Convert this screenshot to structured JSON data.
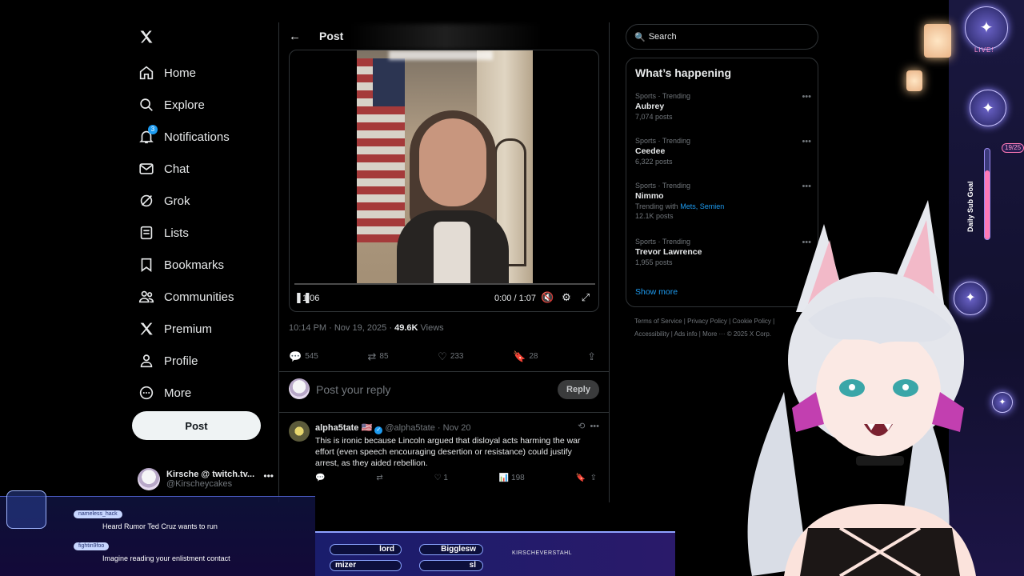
{
  "nav": {
    "items": [
      {
        "label": "Home",
        "icon": "home-icon"
      },
      {
        "label": "Explore",
        "icon": "search-icon"
      },
      {
        "label": "Notifications",
        "icon": "bell-icon",
        "badge": "3"
      },
      {
        "label": "Chat",
        "icon": "mail-icon"
      },
      {
        "label": "Grok",
        "icon": "grok-icon"
      },
      {
        "label": "Lists",
        "icon": "list-icon"
      },
      {
        "label": "Bookmarks",
        "icon": "bookmark-icon"
      },
      {
        "label": "Communities",
        "icon": "people-icon"
      },
      {
        "label": "Premium",
        "icon": "x-icon"
      },
      {
        "label": "Profile",
        "icon": "person-icon"
      },
      {
        "label": "More",
        "icon": "more-circle-icon"
      }
    ],
    "post_label": "Post",
    "account": {
      "name": "Kirsche @ twitch.tv...",
      "handle": "@Kirscheycakes"
    }
  },
  "post": {
    "header_title": "Post",
    "video": {
      "current_time": "0:00 / 1:07",
      "overlay_time": "1:06"
    },
    "timestamp": "10:14 PM · Nov 19, 2025 · ",
    "views_count": "49.6K",
    "views_label": " Views",
    "actions": {
      "replies": "545",
      "reposts": "85",
      "likes": "233",
      "bookmarks": "28"
    },
    "reply_placeholder": "Post your reply",
    "reply_button": "Reply"
  },
  "reply": {
    "name": "alpha5tate",
    "flag": "🇺🇸",
    "handle_date": "@alpha5tate · Nov 20",
    "text": "This is ironic because Lincoln argued that disloyal acts harming the war effort (even speech encouraging desertion or resistance) could justify arrest, as they aided rebellion.",
    "likes": "1",
    "views": "198"
  },
  "sidebar": {
    "search_placeholder": "Search",
    "trends_title": "What’s happening",
    "trends": [
      {
        "category": "Sports · Trending",
        "name": "Aubrey",
        "count": "7,074 posts"
      },
      {
        "category": "Sports · Trending",
        "name": "Ceedee",
        "count": "6,322 posts"
      },
      {
        "category": "Sports · Trending",
        "name": "Nimmo",
        "with_prefix": "Trending with ",
        "with_links": "Mets, Semien",
        "count": "12.1K posts"
      },
      {
        "category": "Sports · Trending",
        "name": "Trevor Lawrence",
        "count": "1,955 posts"
      }
    ],
    "show_more": "Show more",
    "footer_line1": "Terms of Service  |  Privacy Policy  |  Cookie Policy  |",
    "footer_line2": "Accessibility  |  Ads info  |  More ···  © 2025 X Corp."
  },
  "stream": {
    "live_label": "LIVE!",
    "sub_goal_label": "Daily Sub Goal",
    "sub_goal_count": "19/25",
    "sub_goal_progress": 0.76,
    "chat": [
      {
        "user": "nameless_hack",
        "text": "Heard Rumor Ted Cruz wants to run"
      },
      {
        "user": "fightin9foo",
        "text": "Imagine reading your enlistment contact"
      }
    ],
    "bar_pills": [
      "lord",
      "Bigglesw",
      "mizer",
      "sl"
    ],
    "twitter_tag": "KIRSCHEVERSTAHL"
  },
  "colors": {
    "accent": "#1d9bf0",
    "background": "#000000",
    "border": "#2f3336",
    "muted": "#71767b"
  }
}
